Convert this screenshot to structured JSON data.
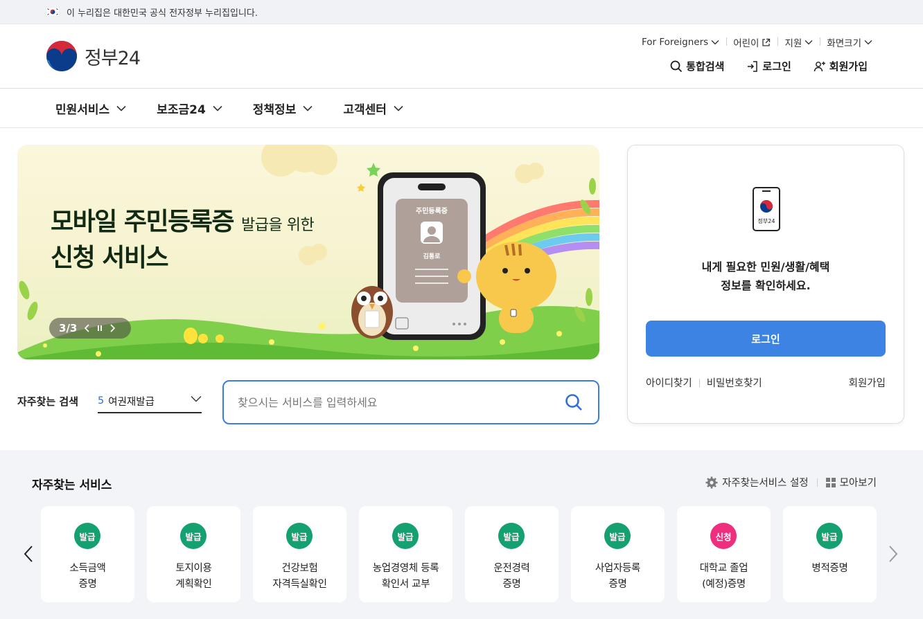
{
  "gov_strip": {
    "text": "이 누리집은 대한민국 공식 전자정부 누리집입니다."
  },
  "header": {
    "logo_text": "정부24",
    "util_links": [
      {
        "label": "For Foreigners",
        "icon": "chevron-down-icon"
      },
      {
        "label": "어린이",
        "icon": "external-link-icon"
      },
      {
        "label": "지원",
        "icon": "chevron-down-icon"
      },
      {
        "label": "화면크기",
        "icon": "chevron-down-icon"
      }
    ],
    "actions": {
      "search": "통합검색",
      "login": "로그인",
      "signup": "회원가입"
    }
  },
  "gnb": {
    "items": [
      "민원서비스",
      "보조금24",
      "정책정보",
      "고객센터"
    ]
  },
  "banner": {
    "title_bold": "모바일 주민등록증",
    "title_rest": "발급을 위한",
    "title_line2": "신청 서비스",
    "card_title": "주민등록증",
    "card_name": "김통로",
    "pager": {
      "current": "3",
      "separator": "/",
      "total": "3"
    }
  },
  "quick_search": {
    "label": "자주찾는 검색",
    "selected_rank": "5",
    "selected_value": "여권재발급",
    "placeholder": "찾으시는 서비스를 입력하세요"
  },
  "login_card": {
    "brand": "정부24",
    "message_line1": "내게 필요한 민원/생활/혜택",
    "message_line2": "정보를 확인하세요.",
    "login_button": "로그인",
    "find_id": "아이디찾기",
    "find_pw": "비밀번호찾기",
    "signup": "회원가입"
  },
  "favorites": {
    "title": "자주찾는 서비스",
    "settings": "자주찾는서비스 설정",
    "view_all": "모아보기",
    "colors": {
      "issue": "#14a06f",
      "apply": "#ee2f7f"
    },
    "cards": [
      {
        "badge": "발급",
        "type": "issue",
        "label": "소득금액\n증명"
      },
      {
        "badge": "발급",
        "type": "issue",
        "label": "토지이용\n계획확인"
      },
      {
        "badge": "발급",
        "type": "issue",
        "label": "건강보험\n자격득실확인"
      },
      {
        "badge": "발급",
        "type": "issue",
        "label": "농업경영체 등록\n확인서 교부"
      },
      {
        "badge": "발급",
        "type": "issue",
        "label": "운전경력\n증명"
      },
      {
        "badge": "발급",
        "type": "issue",
        "label": "사업자등록\n증명"
      },
      {
        "badge": "신청",
        "type": "apply",
        "label": "대학교 졸업\n(예정)증명"
      },
      {
        "badge": "발급",
        "type": "issue",
        "label": "병적증명"
      }
    ]
  }
}
